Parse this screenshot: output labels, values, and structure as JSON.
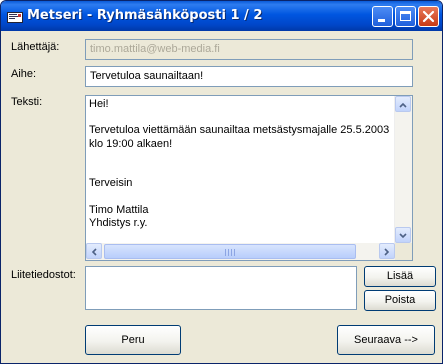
{
  "window": {
    "title": "Metseri - Ryhmäsähköposti 1 / 2"
  },
  "fields": {
    "sender_label": "Lähettäjä:",
    "sender_value": "timo.mattila@web-media.fi",
    "subject_label": "Aihe:",
    "subject_value": "Tervetuloa saunailtaan!",
    "body_label": "Teksti:",
    "body_lines": [
      "Hei!",
      "",
      "Tervetuloa viettämään saunailtaa metsästysmajalle 25.5.2003",
      "klo 19:00 alkaen!",
      "",
      "",
      "Terveisin",
      "",
      "Timo Mattila",
      "Yhdistys r.y."
    ],
    "attachments_label": "Liitetiedostot:"
  },
  "buttons": {
    "add": "Lisää",
    "remove": "Poista",
    "cancel": "Peru",
    "next": "Seuraava -->"
  },
  "icons": {
    "app": "envelope-icon",
    "minimize": "minimize-icon",
    "maximize": "maximize-icon",
    "close": "close-icon"
  }
}
